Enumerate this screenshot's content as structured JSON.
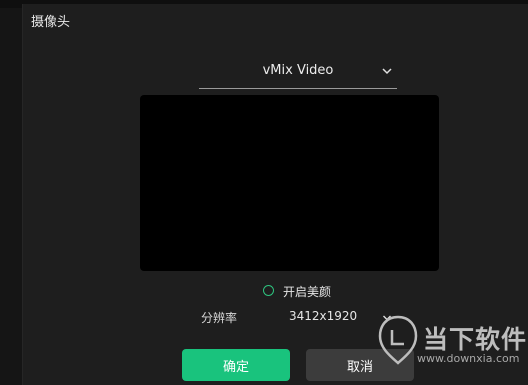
{
  "dialog": {
    "title": "摄像头"
  },
  "camera_select": {
    "value": "vMix Video",
    "icon": "chevron-down-icon"
  },
  "beauty": {
    "label": "开启美颜",
    "checked": false
  },
  "resolution": {
    "label": "分辨率",
    "value": "3412x1920",
    "icon": "chevron-down-icon"
  },
  "buttons": {
    "ok_label": "确定",
    "cancel_label": "取消"
  },
  "watermark": {
    "text": "当下软件园",
    "url": "www.downxia.com"
  },
  "colors": {
    "accent": "#19c37d",
    "radio": "#2ec27e",
    "dialog_bg": "#1e1e1e",
    "preview_bg": "#000000",
    "cancel_bg": "#3c3c3c"
  }
}
